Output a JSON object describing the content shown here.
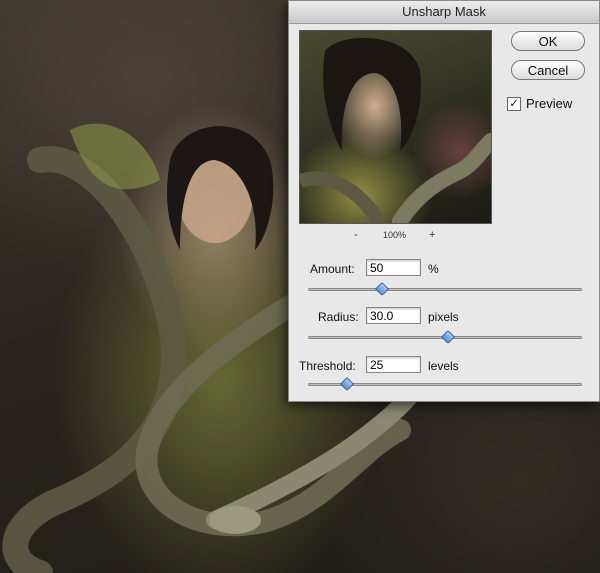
{
  "dialog": {
    "title": "Unsharp Mask",
    "ok_label": "OK",
    "cancel_label": "Cancel",
    "preview_label": "Preview",
    "preview_checked": true,
    "zoom": {
      "minus": "-",
      "level": "100%",
      "plus": "+"
    },
    "fields": [
      {
        "label": "Amount:",
        "value": "50",
        "unit": "%",
        "slider_fraction": 0.27
      },
      {
        "label": "Radius:",
        "value": "30.0",
        "unit": "pixels",
        "slider_fraction": 0.51
      },
      {
        "label": "Threshold:",
        "value": "25",
        "unit": "levels",
        "slider_fraction": 0.14
      }
    ]
  },
  "colors": {
    "accent": "#5b8fd0",
    "dialog_bg": "#e8e8e8"
  }
}
